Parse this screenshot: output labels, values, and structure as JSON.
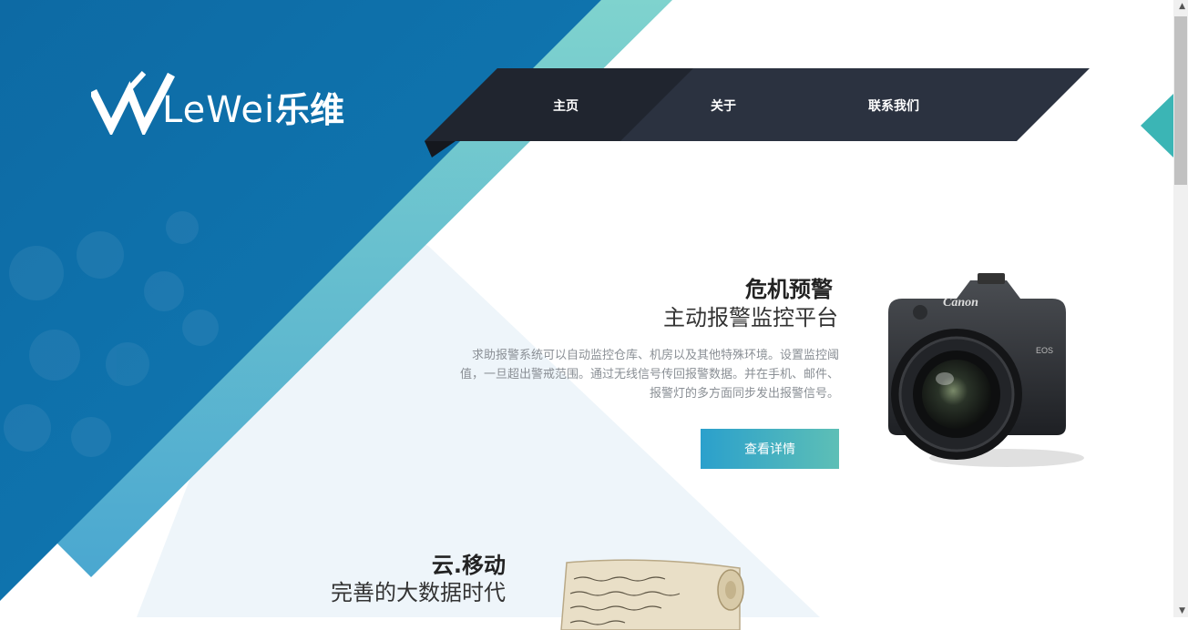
{
  "brand": {
    "logo_text": "LeWei",
    "logo_cn": "乐维"
  },
  "nav": {
    "items": [
      {
        "label": "主页"
      },
      {
        "label": "关于"
      },
      {
        "label": "联系我们"
      }
    ]
  },
  "section1": {
    "title": "危机预警",
    "subtitle": "主动报警监控平台",
    "description": "求助报警系统可以自动监控仓库、机房以及其他特殊环境。设置监控阈值，一旦超出警戒范围。通过无线信号传回报警数据。并在手机、邮件、报警灯的多方面同步发出报警信号。",
    "button": "查看详情",
    "image_icon": "camera-image"
  },
  "section2": {
    "title": "云.移动",
    "subtitle": "完善的大数据时代",
    "image_icon": "scroll-image"
  },
  "colors": {
    "primary": "#0a6aa8",
    "teal": "#7fd3ce",
    "nav_dark": "#252b36",
    "button_start": "#2ba0cc",
    "button_end": "#5dbfb6"
  }
}
